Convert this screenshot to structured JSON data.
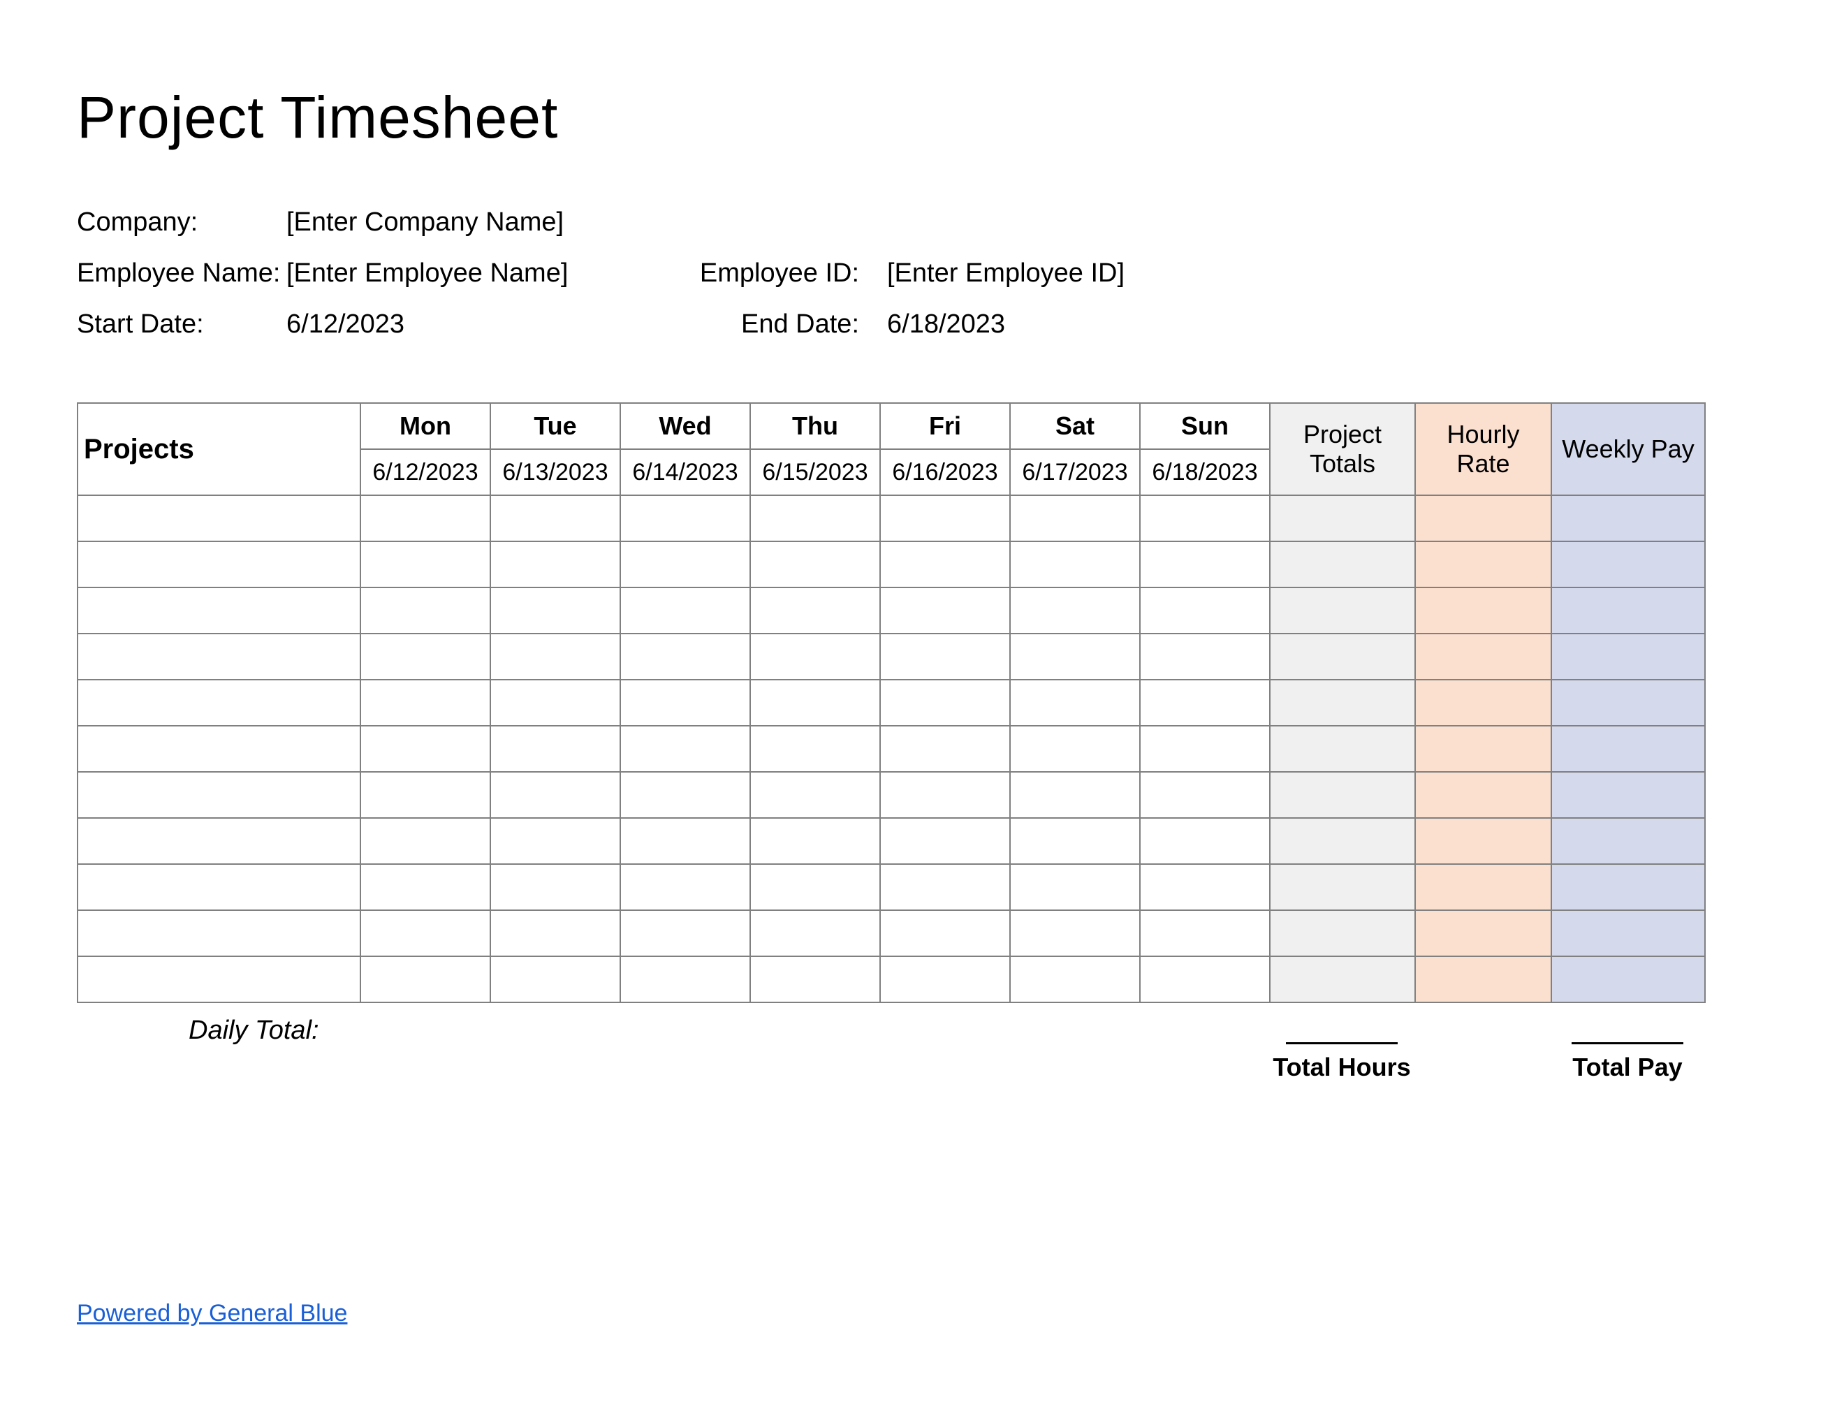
{
  "title": "Project Timesheet",
  "info": {
    "company_label": "Company:",
    "company_value": "[Enter Company Name]",
    "employee_name_label": "Employee Name:",
    "employee_name_value": "[Enter Employee Name]",
    "employee_id_label": "Employee ID:",
    "employee_id_value": "[Enter Employee ID]",
    "start_date_label": "Start Date:",
    "start_date_value": "6/12/2023",
    "end_date_label": "End Date:",
    "end_date_value": "6/18/2023"
  },
  "table": {
    "projects_header": "Projects",
    "days": [
      {
        "abbr": "Mon",
        "date": "6/12/2023"
      },
      {
        "abbr": "Tue",
        "date": "6/13/2023"
      },
      {
        "abbr": "Wed",
        "date": "6/14/2023"
      },
      {
        "abbr": "Thu",
        "date": "6/15/2023"
      },
      {
        "abbr": "Fri",
        "date": "6/16/2023"
      },
      {
        "abbr": "Sat",
        "date": "6/17/2023"
      },
      {
        "abbr": "Sun",
        "date": "6/18/2023"
      }
    ],
    "project_totals_header": "Project Totals",
    "hourly_rate_header": "Hourly Rate",
    "weekly_pay_header": "Weekly Pay",
    "row_count": 11
  },
  "footer": {
    "daily_total_label": "Daily Total:",
    "total_hours_label": "Total Hours",
    "total_pay_label": "Total Pay",
    "credit_text": "Powered by General Blue"
  }
}
